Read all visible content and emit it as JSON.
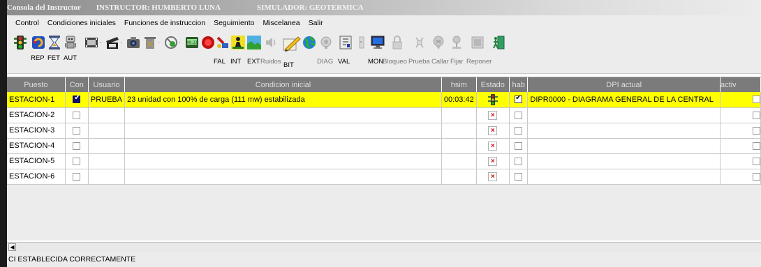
{
  "window": {
    "app_title": "Consola del Instructor",
    "instructor": "INSTRUCTOR: HUMBERTO LUNA",
    "simulator": "SIMULADOR: GEOTERMICA"
  },
  "menu": [
    "Control",
    "Condiciones iniciales",
    "Funciones de instruccion",
    "Seguimiento",
    "Miscelanea",
    "Salir"
  ],
  "toolbar": {
    "labels": {
      "rep": "REP",
      "fet": "FET",
      "aut": "AUT",
      "fal": "FAL",
      "int": "INT",
      "ext": "EXT",
      "ruidos": "Ruidos",
      "bit": "BIT",
      "diag": "DIAG",
      "val": "VAL",
      "mon": "MON",
      "bloqueo": "Bloqueo",
      "prueba": "Prueba",
      "callar": "Callar",
      "fijar": "Fijar",
      "reponer": "Reponer"
    }
  },
  "table": {
    "columns": [
      "Puesto",
      "Con",
      "Usuario",
      "Condicion inicial",
      "hsim",
      "Estado",
      "hab",
      "DPI actual",
      "activ"
    ],
    "rows": [
      {
        "puesto": "ESTACION-1",
        "con": true,
        "usuario": "PRUEBA",
        "condicion": "23 unidad con 100% de carga (111 mw) estabilizada",
        "hsim": "00:03:42",
        "estado": "traffic-light",
        "hab": true,
        "dpi": "DIPR0000 - DIAGRAMA GENERAL DE LA CENTRAL",
        "selected": true
      },
      {
        "puesto": "ESTACION-2",
        "con": false,
        "usuario": "",
        "condicion": "",
        "hsim": "",
        "estado": "x",
        "hab": false,
        "dpi": "",
        "selected": false
      },
      {
        "puesto": "ESTACION-3",
        "con": false,
        "usuario": "",
        "condicion": "",
        "hsim": "",
        "estado": "x",
        "hab": false,
        "dpi": "",
        "selected": false
      },
      {
        "puesto": "ESTACION-4",
        "con": false,
        "usuario": "",
        "condicion": "",
        "hsim": "",
        "estado": "x",
        "hab": false,
        "dpi": "",
        "selected": false
      },
      {
        "puesto": "ESTACION-5",
        "con": false,
        "usuario": "",
        "condicion": "",
        "hsim": "",
        "estado": "x",
        "hab": false,
        "dpi": "",
        "selected": false
      },
      {
        "puesto": "ESTACION-6",
        "con": false,
        "usuario": "",
        "condicion": "",
        "hsim": "",
        "estado": "x",
        "hab": false,
        "dpi": "",
        "selected": false
      }
    ]
  },
  "status": {
    "message": "CI ESTABLECIDA CORRECTAMENTE"
  },
  "colors": {
    "selected_row": "#ffff00",
    "header_bg": "#7b7b7b",
    "checkbox_blue": "#10106a",
    "error_x": "#d21010"
  }
}
